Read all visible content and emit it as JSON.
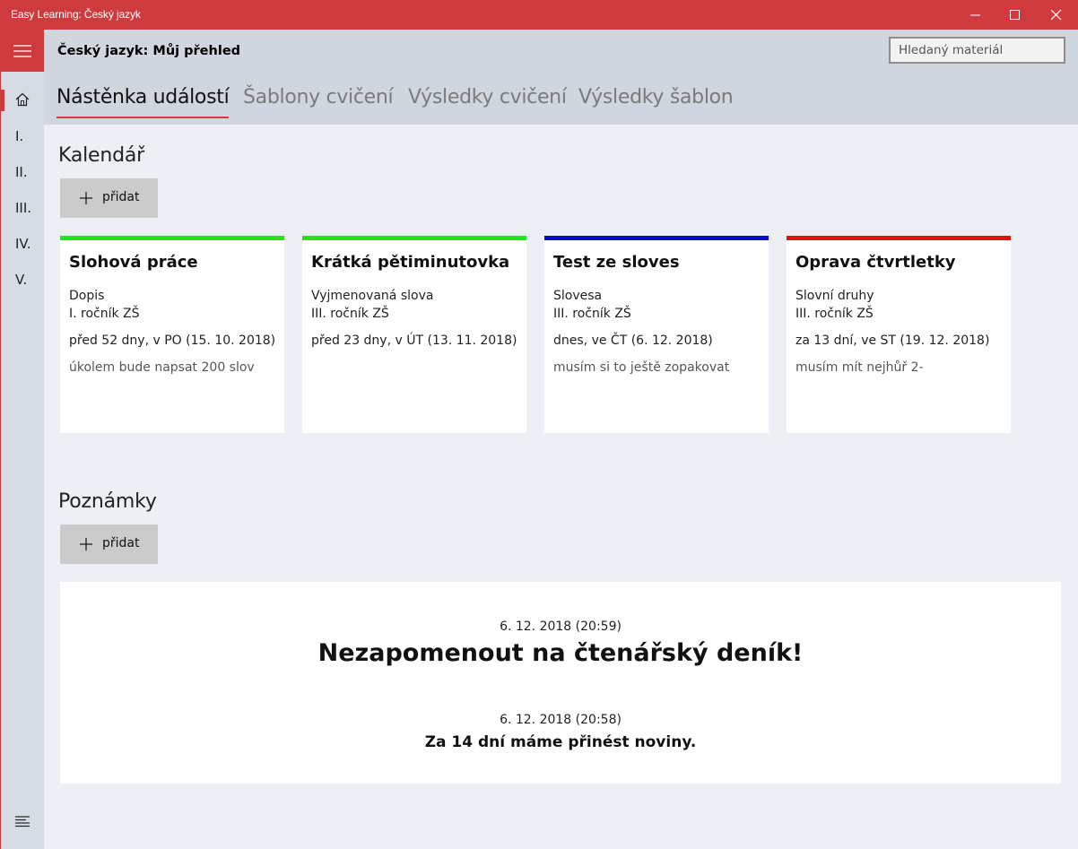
{
  "window": {
    "title": "Easy Learning: Český jazyk",
    "accent": "#cd3b3f"
  },
  "rail": {
    "items": [
      {
        "label": "I."
      },
      {
        "label": "II."
      },
      {
        "label": "III."
      },
      {
        "label": "IV."
      },
      {
        "label": "V."
      }
    ]
  },
  "header": {
    "title": "Český jazyk: Můj přehled",
    "search_placeholder": "Hledaný materiál",
    "tabs": [
      {
        "label": "Nástěnka událostí",
        "active": true
      },
      {
        "label": "Šablony cvičení"
      },
      {
        "label": "Výsledky cvičení"
      },
      {
        "label": "Výsledky šablon"
      }
    ]
  },
  "calendar": {
    "title": "Kalendář",
    "add_label": "přidat",
    "cards": [
      {
        "title": "Slohová práce",
        "subject": "Dopis",
        "grade": "I. ročník ZŠ",
        "when": "před 52 dny, v PO (15. 10. 2018)",
        "note": "úkolem bude napsat 200 slov",
        "color": "#22e222"
      },
      {
        "title": "Krátká pětiminutovka",
        "subject": "Vyjmenovaná slova",
        "grade": "III. ročník ZŠ",
        "when": "před 23 dny, v ÚT (13. 11. 2018)",
        "note": "",
        "color": "#22e222"
      },
      {
        "title": "Test ze sloves",
        "subject": "Slovesa",
        "grade": "III. ročník ZŠ",
        "when": "dnes, ve ČT (6. 12. 2018)",
        "note": "musím si to ještě zopakovat",
        "color": "#0a0ac8"
      },
      {
        "title": "Oprava čtvrtletky",
        "subject": "Slovní druhy",
        "grade": "III. ročník ZŠ",
        "when": "za 13 dní, ve ST (19. 12. 2018)",
        "note": "musím mít nejhůř 2-",
        "color": "#e01010"
      }
    ]
  },
  "notes": {
    "title": "Poznámky",
    "add_label": "přidat",
    "items": [
      {
        "date": "6. 12. 2018 (20:59)",
        "text": "Nezapomenout na čtenářský deník!"
      },
      {
        "date": "6. 12. 2018 (20:58)",
        "text": "Za 14 dní máme přinést noviny."
      }
    ]
  }
}
